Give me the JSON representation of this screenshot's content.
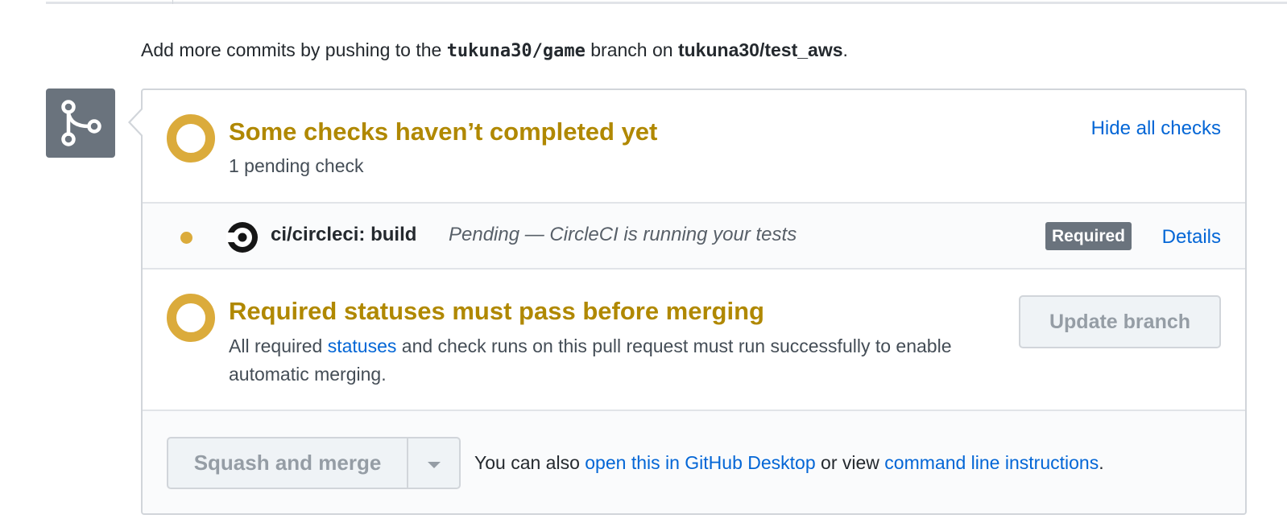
{
  "push_note": {
    "prefix": "Add more commits by pushing to the ",
    "branch": "tukuna30/game",
    "middle": " branch on ",
    "repo": "tukuna30/test_aws",
    "suffix": "."
  },
  "checks": {
    "title": "Some checks haven’t completed yet",
    "subtitle": "1 pending check",
    "toggle_label": "Hide all checks",
    "items": [
      {
        "name": "ci/circleci: build",
        "description": "Pending — CircleCI is running your tests",
        "badge": "Required",
        "details_label": "Details",
        "icon": "circleci-logo-icon",
        "status": "pending"
      }
    ]
  },
  "required_statuses": {
    "title": "Required statuses must pass before merging",
    "desc_prefix": "All required ",
    "desc_link": "statuses",
    "desc_suffix": " and check runs on this pull request must run successfully to enable automatic merging.",
    "update_button": "Update branch"
  },
  "merge": {
    "button_label": "Squash and merge",
    "note_prefix": "You can also ",
    "desktop_link": "open this in GitHub Desktop",
    "note_middle": " or view ",
    "cli_link": "command line instructions",
    "note_suffix": "."
  },
  "colors": {
    "pending": "#dbab3b",
    "pending_text": "#b08800",
    "link": "#0366d6",
    "badge_bg": "#6a737d"
  }
}
